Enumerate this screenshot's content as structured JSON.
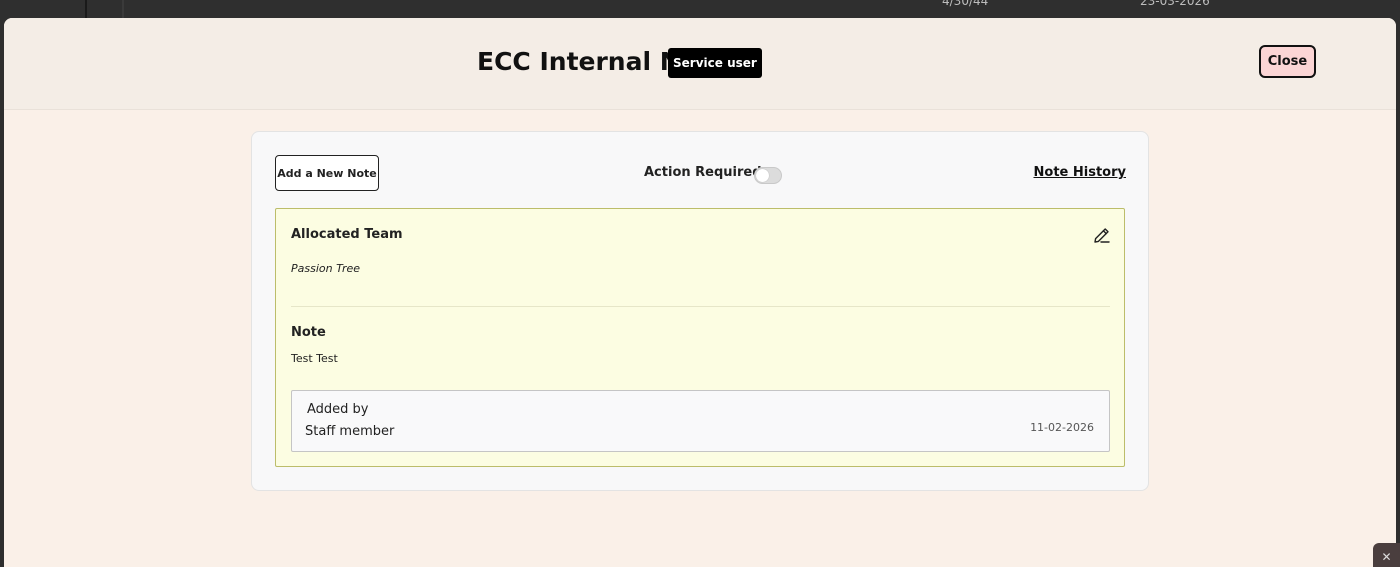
{
  "background": {
    "col_a_text": "4/30/44",
    "col_b_text": "23-03-2026"
  },
  "modal": {
    "title": "ECC Internal Note",
    "badge": "Service user",
    "close_label": "Close"
  },
  "toolbar": {
    "add_note_label": "Add a New Note",
    "action_required_label": "Action Required",
    "action_required_on": false,
    "note_history_label": "Note History"
  },
  "note": {
    "team_heading": "Allocated Team",
    "team_value": "Passion Tree",
    "note_heading": "Note",
    "note_text": "Test Test",
    "added_by_label": "Added by",
    "added_by_name": "Staff member",
    "added_date": "11-02-2026"
  },
  "colors": {
    "note_background": "#fcfde2",
    "note_border": "#bcbd6a",
    "close_button_bg": "#fbd5d5",
    "badge_bg": "#000000"
  },
  "icons": {
    "edit": "pencil-icon",
    "corner_close": "close-icon"
  },
  "corner": {
    "symbol": "✕"
  }
}
